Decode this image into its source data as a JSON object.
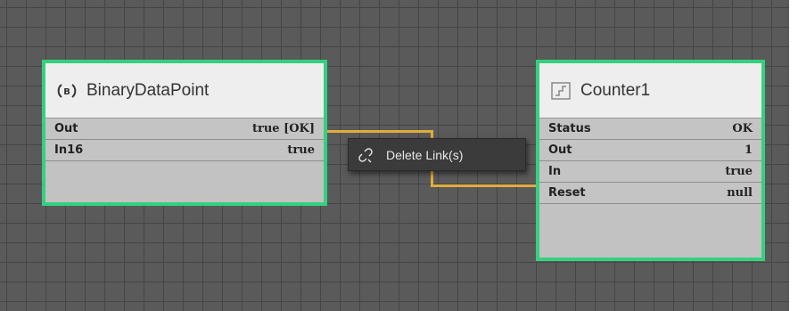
{
  "blocks": {
    "binary": {
      "title": "BinaryDataPoint",
      "icon": "binary-datapoint-icon",
      "rows": [
        {
          "label": "Out",
          "value": "true [OK]"
        },
        {
          "label": "In16",
          "value": "true"
        }
      ]
    },
    "counter": {
      "title": "Counter1",
      "icon": "counter-icon",
      "rows": [
        {
          "label": "Status",
          "value": "OK"
        },
        {
          "label": "Out",
          "value": "1"
        },
        {
          "label": "In",
          "value": "true"
        },
        {
          "label": "Reset",
          "value": "null"
        }
      ]
    }
  },
  "context_menu": {
    "items": [
      {
        "label": "Delete Link(s)",
        "icon": "unlink-icon"
      }
    ]
  },
  "colors": {
    "selection_border": "#35d07f",
    "link_wire": "#e0ad3b",
    "canvas": "#5a5a5a"
  }
}
